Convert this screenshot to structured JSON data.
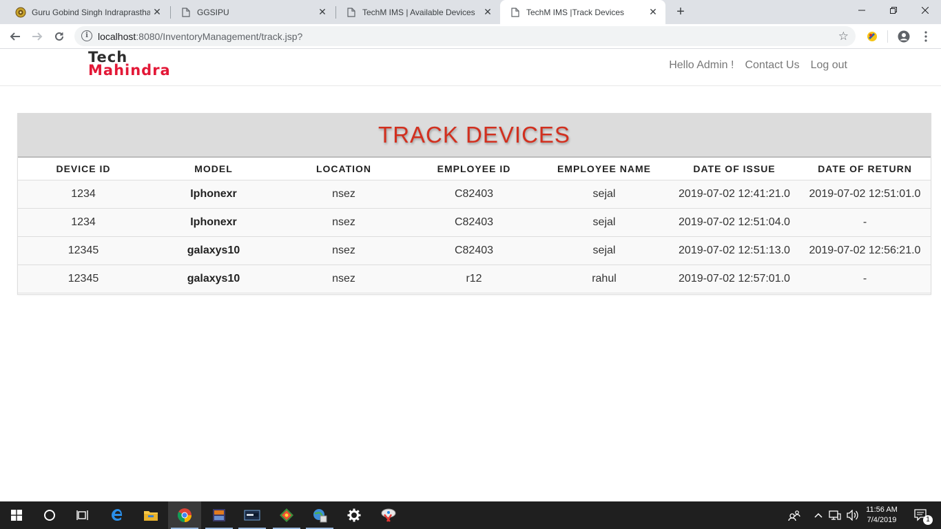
{
  "browser": {
    "tabs": [
      {
        "title": "Guru Gobind Singh Indraprastha",
        "icon": "university-seal-icon"
      },
      {
        "title": "GGSIPU",
        "icon": "page-icon"
      },
      {
        "title": "TechM IMS | Available Devices",
        "icon": "page-icon"
      },
      {
        "title": "TechM IMS |Track Devices",
        "icon": "page-icon"
      }
    ],
    "active_tab": 3,
    "url_host": "localhost",
    "url_rest": ":8080/InventoryManagement/track.jsp?"
  },
  "header": {
    "logo_line1": "Tech",
    "logo_line2": "Mahindra",
    "greeting": "Hello Admin !",
    "contact": "Contact Us",
    "logout": "Log out"
  },
  "panel": {
    "title": "TRACK DEVICES"
  },
  "table": {
    "columns": [
      "DEVICE ID",
      "MODEL",
      "LOCATION",
      "EMPLOYEE ID",
      "EMPLOYEE NAME",
      "DATE OF ISSUE",
      "DATE OF RETURN"
    ],
    "rows": [
      [
        "1234",
        "Iphonexr",
        "nsez",
        "C82403",
        "sejal",
        "2019-07-02 12:41:21.0",
        "2019-07-02 12:51:01.0"
      ],
      [
        "1234",
        "Iphonexr",
        "nsez",
        "C82403",
        "sejal",
        "2019-07-02 12:51:04.0",
        "-"
      ],
      [
        "12345",
        "galaxys10",
        "nsez",
        "C82403",
        "sejal",
        "2019-07-02 12:51:13.0",
        "2019-07-02 12:56:21.0"
      ],
      [
        "12345",
        "galaxys10",
        "nsez",
        "r12",
        "rahul",
        "2019-07-02 12:57:01.0",
        "-"
      ]
    ]
  },
  "taskbar": {
    "time": "11:56 AM",
    "date": "7/4/2019",
    "notification_count": "1"
  },
  "colors": {
    "brand_red": "#e31837",
    "title_red": "#d22f1e",
    "panel_head": "#dcdcdc",
    "taskbar": "#1f1f1f"
  }
}
